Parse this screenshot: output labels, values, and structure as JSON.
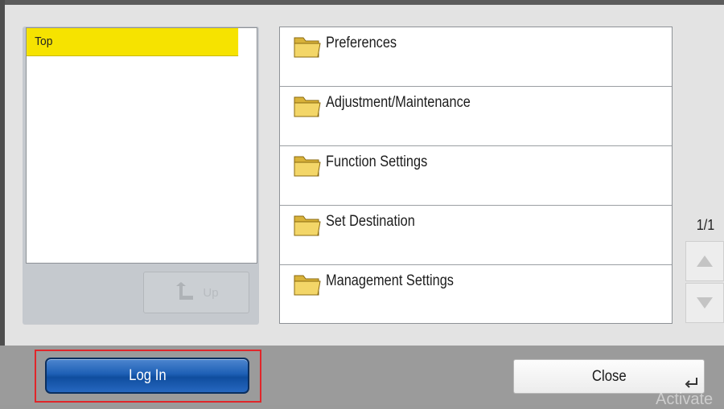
{
  "tree": {
    "selected_label": "Top",
    "up_button_label": "Up"
  },
  "folders": [
    {
      "label": "Preferences"
    },
    {
      "label": "Adjustment/Maintenance"
    },
    {
      "label": "Function Settings"
    },
    {
      "label": "Set Destination"
    },
    {
      "label": "Management Settings"
    }
  ],
  "paging": {
    "page_indicator": "1/1"
  },
  "footer": {
    "login_label": "Log In",
    "close_label": "Close"
  },
  "watermark": "Activate",
  "colors": {
    "selected_highlight": "#f6e300",
    "login_button": "#1d5fb5",
    "focus_outline": "#e0262a"
  },
  "icons": [
    "folder-icon",
    "up-arrow-icon",
    "scroll-up-icon",
    "scroll-down-icon",
    "enter-icon"
  ]
}
